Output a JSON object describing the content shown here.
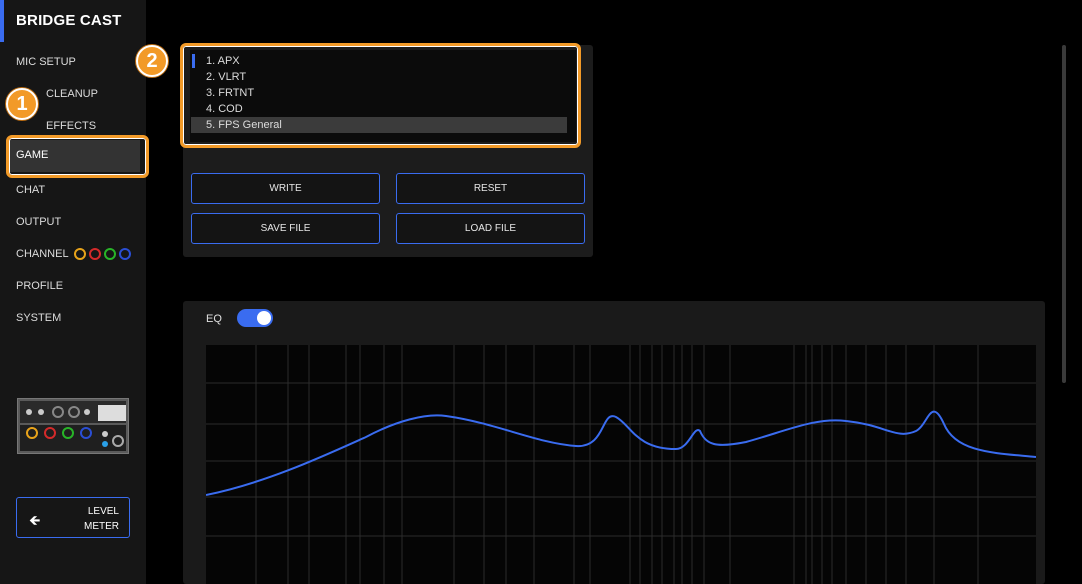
{
  "app": {
    "title": "BRIDGE CAST"
  },
  "sidebar": {
    "items": [
      {
        "label": "MIC SETUP"
      },
      {
        "label": "CLEANUP"
      },
      {
        "label": "EFFECTS"
      },
      {
        "label": "GAME"
      },
      {
        "label": "CHAT"
      },
      {
        "label": "OUTPUT"
      },
      {
        "label": "CHANNEL"
      },
      {
        "label": "PROFILE"
      },
      {
        "label": "SYSTEM"
      }
    ],
    "channel_colors": [
      "#e8a31a",
      "#d42a2a",
      "#28b428",
      "#2a4ed4"
    ],
    "level_meter": {
      "line1": "LEVEL",
      "line2": "METER"
    }
  },
  "annotations": {
    "one": "1",
    "two": "2",
    "color": "#f29a28"
  },
  "presets": {
    "items": [
      "1. APX",
      "2. VLRT",
      "3. FRTNT",
      "4. COD",
      "5. FPS General"
    ],
    "selected_index": 4
  },
  "buttons": {
    "write": "WRITE",
    "reset": "RESET",
    "save_file": "SAVE FILE",
    "load_file": "LOAD FILE"
  },
  "eq": {
    "label": "EQ",
    "enabled": true,
    "curve_color": "#3a6cf0",
    "accent_color": "#3a6cf0"
  }
}
